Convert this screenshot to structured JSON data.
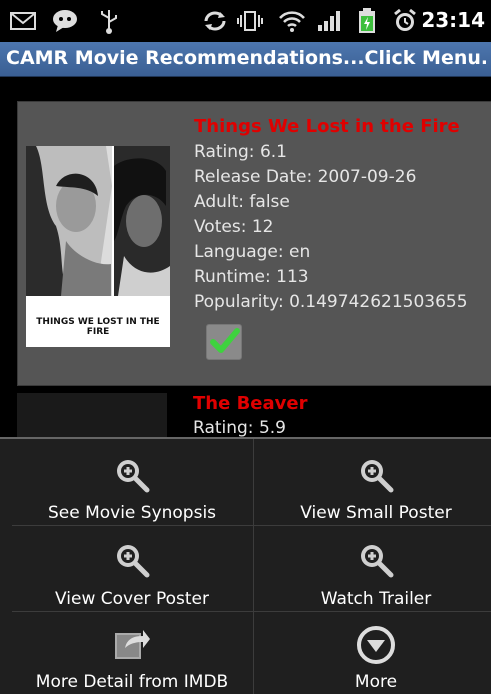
{
  "status_bar": {
    "time": "23:14",
    "icons": [
      "mail-icon",
      "chat-icon",
      "usb-icon",
      "sync-icon",
      "vibrate-icon",
      "wifi-icon",
      "signal-icon",
      "battery-icon",
      "alarm-icon"
    ]
  },
  "title_bar": {
    "title": "CAMR Movie Recommendations...Click Menu..."
  },
  "movies": [
    {
      "title": "Things We Lost in the Fire",
      "rating": "Rating: 6.1",
      "release_date": "Release Date: 2007-09-26",
      "adult": "Adult: false",
      "votes": "Votes: 12",
      "language": "Language: en",
      "runtime": "Runtime: 113",
      "popularity": "Popularity: 0.149742621503655",
      "poster_caption": "THINGS WE LOST IN THE FIRE",
      "selected": true
    },
    {
      "title": "The Beaver",
      "rating": "Rating: 5.9"
    }
  ],
  "menu": {
    "items": [
      {
        "label": "See Movie Synopsis",
        "icon": "zoom-in-icon"
      },
      {
        "label": "View Small Poster",
        "icon": "zoom-in-icon"
      },
      {
        "label": "View Cover Poster",
        "icon": "zoom-in-icon"
      },
      {
        "label": "Watch Trailer",
        "icon": "zoom-in-icon"
      },
      {
        "label": "More Detail from IMDB",
        "icon": "share-icon"
      },
      {
        "label": "More",
        "icon": "more-icon"
      }
    ]
  },
  "colors": {
    "title_bar": "#3f669c",
    "movie_title": "#e00000",
    "card": "#555555",
    "menu_bg": "#1f1f1f",
    "check": "#3ed23e"
  }
}
